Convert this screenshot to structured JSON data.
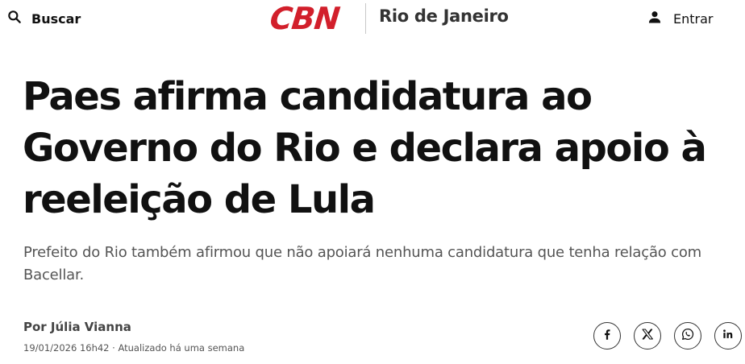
{
  "header": {
    "search_label": "Buscar",
    "logo_text": "CBN",
    "section_label": "Rio de Janeiro",
    "login_label": "Entrar",
    "brand_color": "#d21f2b"
  },
  "article": {
    "headline": "Paes afirma candidatura ao Governo do Rio e declara apoio à reeleição de Lula",
    "subtitle": "Prefeito do Rio também afirmou que não apoiará nenhuma candidatura que tenha relação com Bacellar.",
    "author": "Por Júlia Vianna",
    "meta": "19/01/2026 16h42 · Atualizado há uma semana"
  },
  "share": {
    "icons": [
      "facebook-icon",
      "x-icon",
      "whatsapp-icon",
      "linkedin-icon"
    ]
  }
}
